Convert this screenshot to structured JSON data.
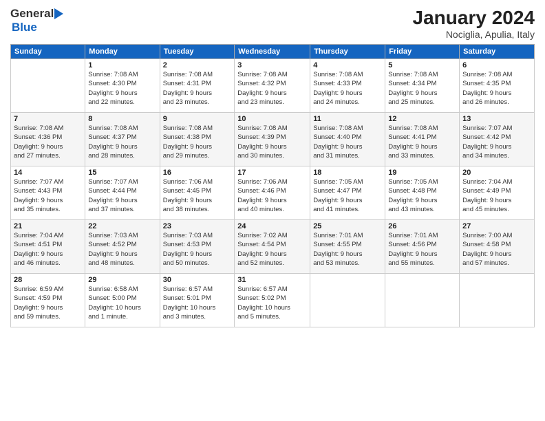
{
  "header": {
    "logo_general": "General",
    "logo_blue": "Blue",
    "month_year": "January 2024",
    "location": "Nociglia, Apulia, Italy"
  },
  "calendar": {
    "days_of_week": [
      "Sunday",
      "Monday",
      "Tuesday",
      "Wednesday",
      "Thursday",
      "Friday",
      "Saturday"
    ],
    "weeks": [
      [
        {
          "day": "",
          "info": ""
        },
        {
          "day": "1",
          "info": "Sunrise: 7:08 AM\nSunset: 4:30 PM\nDaylight: 9 hours\nand 22 minutes."
        },
        {
          "day": "2",
          "info": "Sunrise: 7:08 AM\nSunset: 4:31 PM\nDaylight: 9 hours\nand 23 minutes."
        },
        {
          "day": "3",
          "info": "Sunrise: 7:08 AM\nSunset: 4:32 PM\nDaylight: 9 hours\nand 23 minutes."
        },
        {
          "day": "4",
          "info": "Sunrise: 7:08 AM\nSunset: 4:33 PM\nDaylight: 9 hours\nand 24 minutes."
        },
        {
          "day": "5",
          "info": "Sunrise: 7:08 AM\nSunset: 4:34 PM\nDaylight: 9 hours\nand 25 minutes."
        },
        {
          "day": "6",
          "info": "Sunrise: 7:08 AM\nSunset: 4:35 PM\nDaylight: 9 hours\nand 26 minutes."
        }
      ],
      [
        {
          "day": "7",
          "info": ""
        },
        {
          "day": "8",
          "info": "Sunrise: 7:08 AM\nSunset: 4:37 PM\nDaylight: 9 hours\nand 28 minutes."
        },
        {
          "day": "9",
          "info": "Sunrise: 7:08 AM\nSunset: 4:38 PM\nDaylight: 9 hours\nand 29 minutes."
        },
        {
          "day": "10",
          "info": "Sunrise: 7:08 AM\nSunset: 4:39 PM\nDaylight: 9 hours\nand 30 minutes."
        },
        {
          "day": "11",
          "info": "Sunrise: 7:08 AM\nSunset: 4:40 PM\nDaylight: 9 hours\nand 31 minutes."
        },
        {
          "day": "12",
          "info": "Sunrise: 7:08 AM\nSunset: 4:41 PM\nDaylight: 9 hours\nand 33 minutes."
        },
        {
          "day": "13",
          "info": "Sunrise: 7:07 AM\nSunset: 4:42 PM\nDaylight: 9 hours\nand 34 minutes."
        }
      ],
      [
        {
          "day": "14",
          "info": ""
        },
        {
          "day": "15",
          "info": "Sunrise: 7:07 AM\nSunset: 4:44 PM\nDaylight: 9 hours\nand 37 minutes."
        },
        {
          "day": "16",
          "info": "Sunrise: 7:06 AM\nSunset: 4:45 PM\nDaylight: 9 hours\nand 38 minutes."
        },
        {
          "day": "17",
          "info": "Sunrise: 7:06 AM\nSunset: 4:46 PM\nDaylight: 9 hours\nand 40 minutes."
        },
        {
          "day": "18",
          "info": "Sunrise: 7:05 AM\nSunset: 4:47 PM\nDaylight: 9 hours\nand 41 minutes."
        },
        {
          "day": "19",
          "info": "Sunrise: 7:05 AM\nSunset: 4:48 PM\nDaylight: 9 hours\nand 43 minutes."
        },
        {
          "day": "20",
          "info": "Sunrise: 7:04 AM\nSunset: 4:49 PM\nDaylight: 9 hours\nand 45 minutes."
        }
      ],
      [
        {
          "day": "21",
          "info": ""
        },
        {
          "day": "22",
          "info": "Sunrise: 7:03 AM\nSunset: 4:52 PM\nDaylight: 9 hours\nand 48 minutes."
        },
        {
          "day": "23",
          "info": "Sunrise: 7:03 AM\nSunset: 4:53 PM\nDaylight: 9 hours\nand 50 minutes."
        },
        {
          "day": "24",
          "info": "Sunrise: 7:02 AM\nSunset: 4:54 PM\nDaylight: 9 hours\nand 52 minutes."
        },
        {
          "day": "25",
          "info": "Sunrise: 7:01 AM\nSunset: 4:55 PM\nDaylight: 9 hours\nand 53 minutes."
        },
        {
          "day": "26",
          "info": "Sunrise: 7:01 AM\nSunset: 4:56 PM\nDaylight: 9 hours\nand 55 minutes."
        },
        {
          "day": "27",
          "info": "Sunrise: 7:00 AM\nSunset: 4:58 PM\nDaylight: 9 hours\nand 57 minutes."
        }
      ],
      [
        {
          "day": "28",
          "info": ""
        },
        {
          "day": "29",
          "info": "Sunrise: 6:58 AM\nSunset: 5:00 PM\nDaylight: 10 hours\nand 1 minute."
        },
        {
          "day": "30",
          "info": "Sunrise: 6:57 AM\nSunset: 5:01 PM\nDaylight: 10 hours\nand 3 minutes."
        },
        {
          "day": "31",
          "info": "Sunrise: 6:57 AM\nSunset: 5:02 PM\nDaylight: 10 hours\nand 5 minutes."
        },
        {
          "day": "",
          "info": ""
        },
        {
          "day": "",
          "info": ""
        },
        {
          "day": "",
          "info": ""
        }
      ]
    ],
    "week1_sun_info": "Sunrise: 7:08 AM\nSunset: 4:36 PM\nDaylight: 9 hours\nand 27 minutes.",
    "week2_sun_info": "Sunrise: 7:07 AM\nSunset: 4:43 PM\nDaylight: 9 hours\nand 35 minutes.",
    "week3_sun_info": "Sunrise: 7:04 AM\nSunset: 4:51 PM\nDaylight: 9 hours\nand 46 minutes.",
    "week4_sun_info": "Sunrise: 7:04 AM\nSunset: 4:51 PM\nDaylight: 9 hours\nand 46 minutes.",
    "week5_sun_info": "Sunrise: 6:59 AM\nSunset: 4:59 PM\nDaylight: 9 hours\nand 59 minutes."
  }
}
